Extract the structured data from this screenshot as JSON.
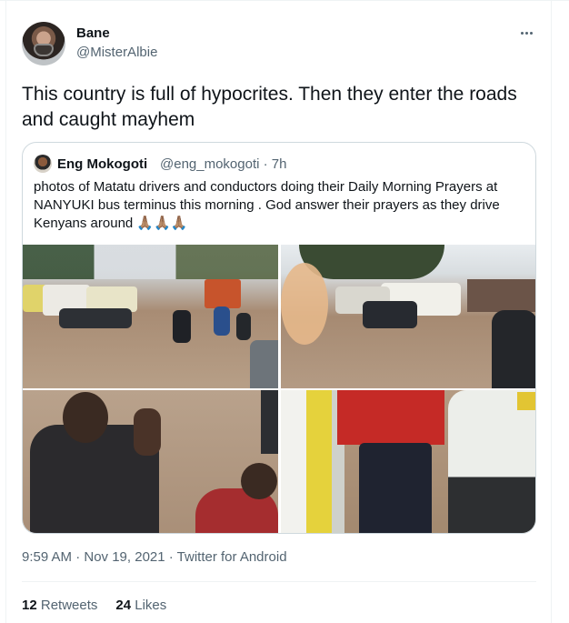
{
  "author": {
    "name": "Bane",
    "handle": "@MisterAlbie",
    "avatar_icon": "avatar-icon"
  },
  "tweet": {
    "text": "This country is full of hypocrites. Then they enter the roads and caught mayhem"
  },
  "quoted": {
    "name": "Eng Mokogoti",
    "handle": "@eng_mokogoti · 7h",
    "text": "photos of Matatu drivers and conductors doing their Daily Morning Prayers at NANYUKI bus terminus this morning . God answer their prayers as they drive Kenyans around 🙏🏽🙏🏽🙏🏽",
    "images": [
      "photo-1",
      "photo-2",
      "photo-3",
      "photo-4"
    ]
  },
  "meta": "9:59 AM · Nov 19, 2021 · Twitter for Android",
  "stats": {
    "retweets_count": "12",
    "retweets_label": "Retweets",
    "likes_count": "24",
    "likes_label": "Likes"
  },
  "colors": {
    "text": "#0f1419",
    "secondary": "#536471",
    "border": "#cfd9de"
  }
}
